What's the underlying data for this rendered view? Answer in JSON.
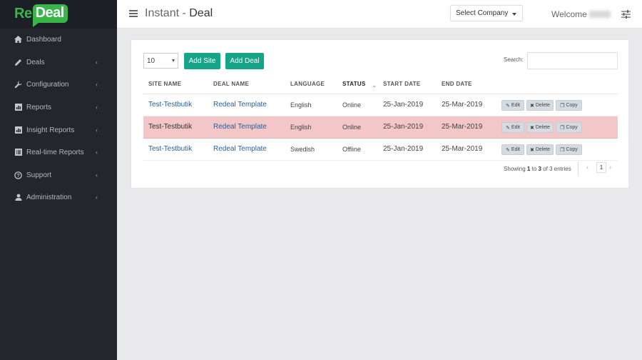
{
  "brand": {
    "logo_prefix": "Re",
    "logo_suffix": "Deal",
    "accent": "#39b54a",
    "teal": "#17a589"
  },
  "sidebar": {
    "items": [
      {
        "label": "Dashboard",
        "icon": "home-icon",
        "has_chevron": false
      },
      {
        "label": "Deals",
        "icon": "pencil-icon",
        "has_chevron": true
      },
      {
        "label": "Configuration",
        "icon": "wrench-icon",
        "has_chevron": true
      },
      {
        "label": "Reports",
        "icon": "bar-chart-icon",
        "has_chevron": true
      },
      {
        "label": "Insight Reports",
        "icon": "bar-chart-icon",
        "has_chevron": true
      },
      {
        "label": "Real-time Reports",
        "icon": "list-alt-icon",
        "has_chevron": true
      },
      {
        "label": "Support",
        "icon": "question-circle-icon",
        "has_chevron": true
      },
      {
        "label": "Administration",
        "icon": "user-icon",
        "has_chevron": true
      }
    ],
    "chevron": "‹"
  },
  "header": {
    "title_prefix": "Instant - ",
    "title_main": "Deal",
    "select_company": "Select Company",
    "welcome": "Welcome"
  },
  "table_controls": {
    "page_size": "10",
    "add_site": "Add Site",
    "add_deal": "Add Deal",
    "search_label": "Search:"
  },
  "table": {
    "columns": [
      "SITE NAME",
      "DEAL NAME",
      "LANGUAGE",
      "STATUS",
      "START DATE",
      "END DATE"
    ],
    "actions": {
      "edit": "Edit",
      "delete": "Delete",
      "copy": "Copy"
    },
    "rows": [
      {
        "site": "Test-Testbutik",
        "deal": "Redeal Template",
        "language": "English",
        "status": "Online",
        "start": "25-Jan-2019",
        "end": "25-Mar-2019",
        "highlight": false
      },
      {
        "site": "Test-Testbutik",
        "deal": "Redeal Template",
        "language": "English",
        "status": "Online",
        "start": "25-Jan-2019",
        "end": "25-Mar-2019",
        "highlight": true
      },
      {
        "site": "Test-Testbutik",
        "deal": "Redeal Template",
        "language": "Swedish",
        "status": "Offline",
        "start": "25-Jan-2019",
        "end": "25-Mar-2019",
        "highlight": false
      }
    ]
  },
  "footer": {
    "info_prefix": "Showing ",
    "info_from": "1",
    "info_mid": " to ",
    "info_to": "3",
    "info_of": " of 3 entries",
    "prev": "‹",
    "page": "1",
    "next": "›"
  }
}
